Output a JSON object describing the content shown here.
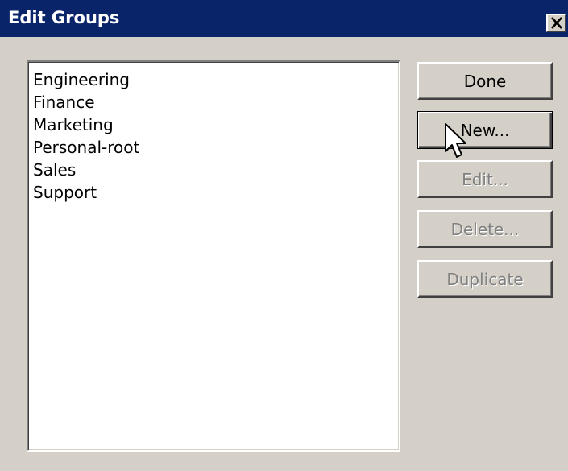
{
  "window": {
    "title": "Edit Groups",
    "close_glyph": "✕",
    "close_icon": "close-icon"
  },
  "groups": {
    "items": [
      "Engineering",
      "Finance",
      "Marketing",
      "Personal-root",
      "Sales",
      "Support"
    ]
  },
  "buttons": {
    "done": "Done",
    "new": "New...",
    "edit": "Edit...",
    "delete": "Delete...",
    "duplicate": "Duplicate"
  },
  "colors": {
    "titlebar": "#0a246a",
    "face": "#d4d0c8",
    "disabled_text": "#808080"
  },
  "cursor_icon": "mouse-pointer-icon"
}
